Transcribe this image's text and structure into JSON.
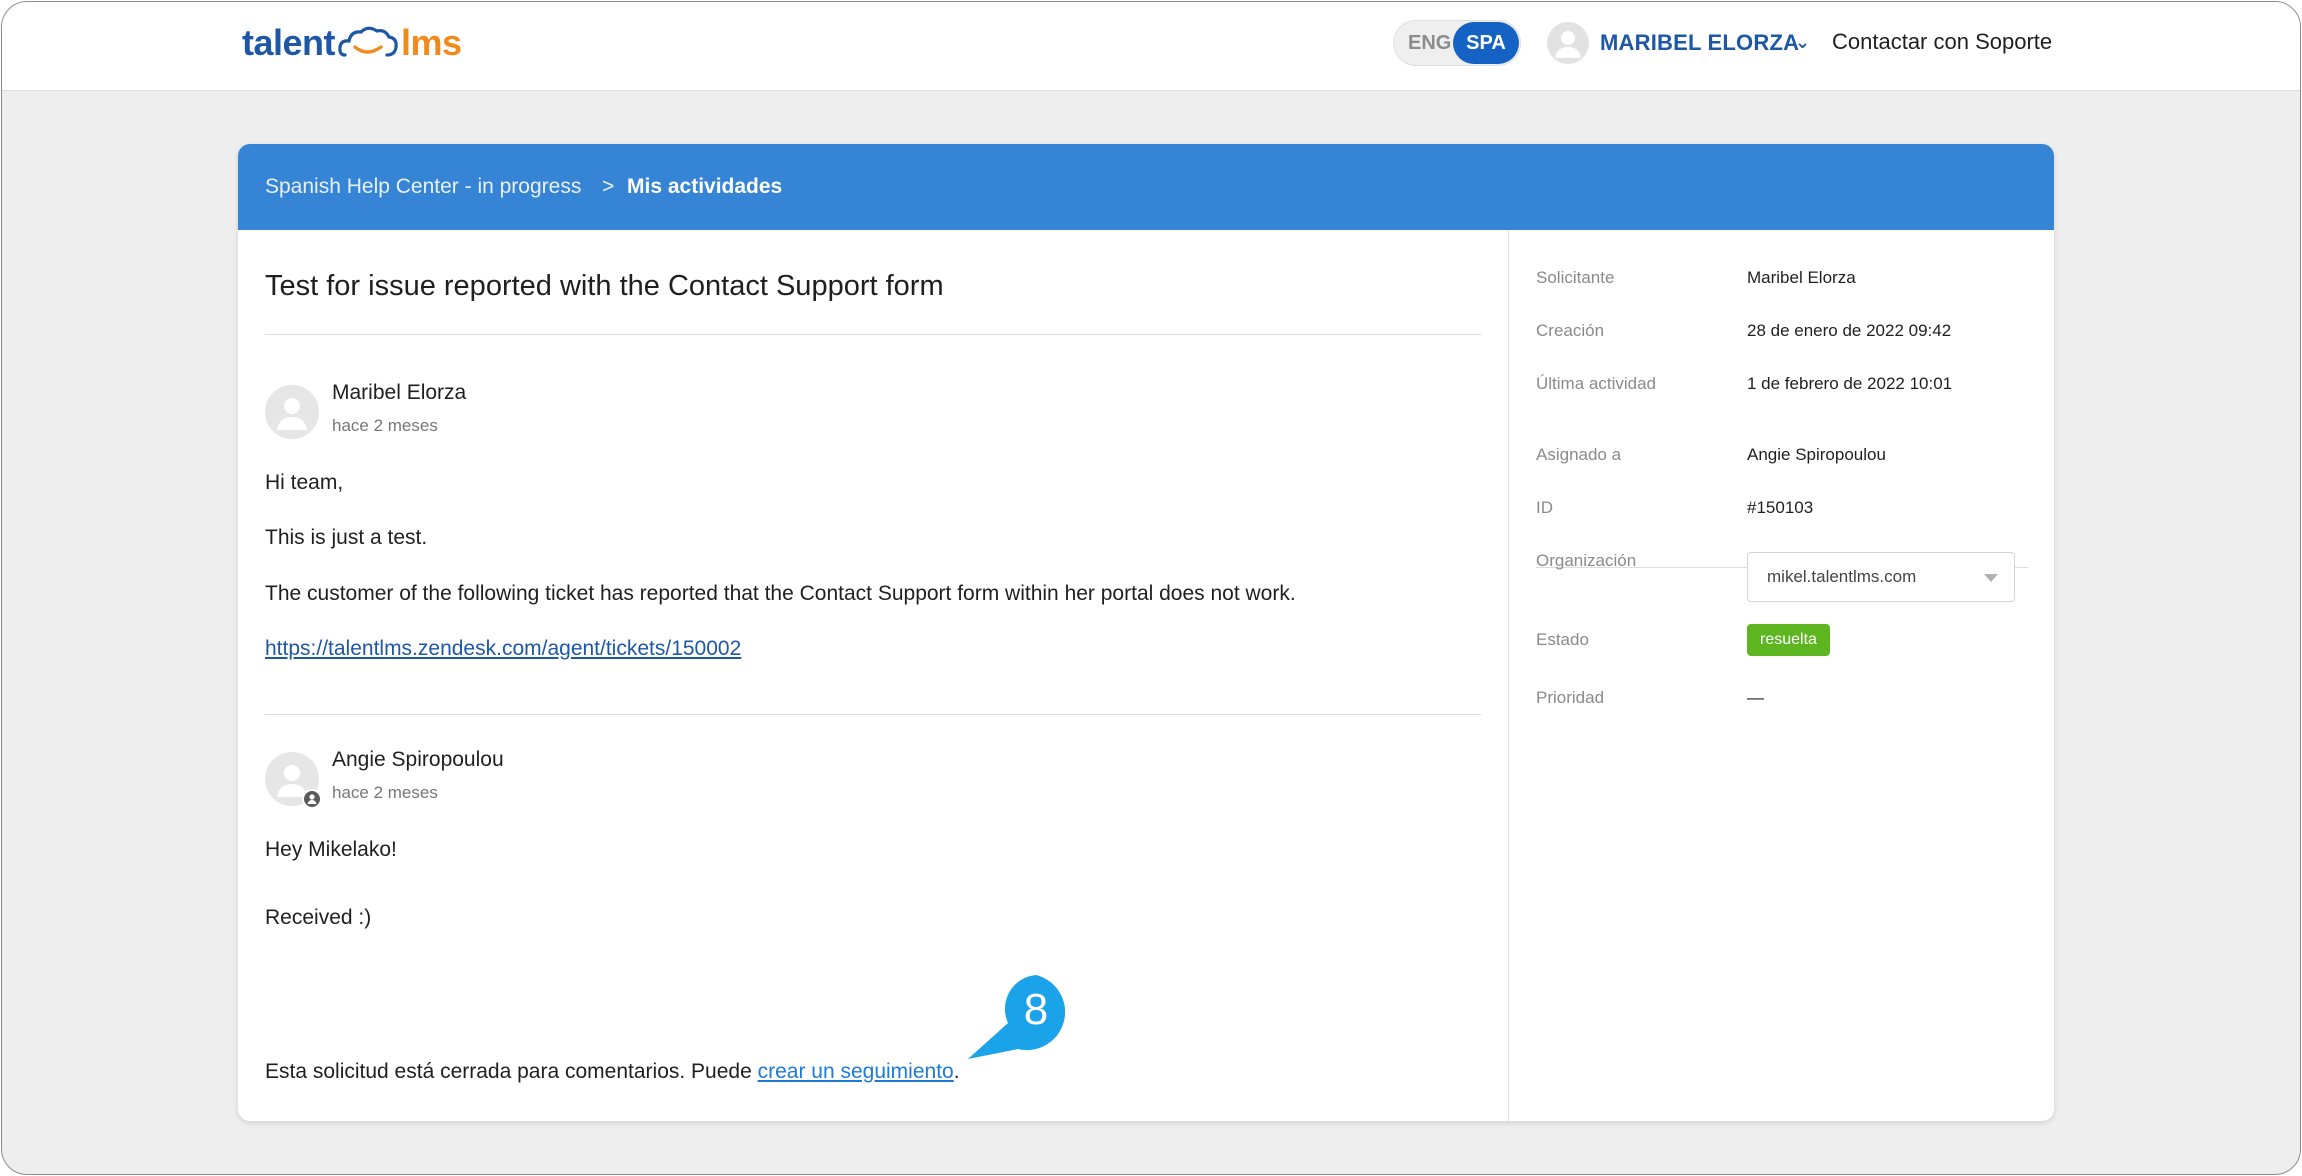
{
  "header": {
    "logo_left": "talent",
    "logo_right": "lms",
    "lang_eng": "ENG",
    "lang_spa": "SPA",
    "user_name": "MARIBEL ELORZA",
    "chevron": "⌄",
    "support_link": "Contactar con Soporte"
  },
  "breadcrumb": {
    "parent": "Spanish Help Center - in progress",
    "separator": ">",
    "current": "Mis actividades"
  },
  "ticket": {
    "title": "Test for issue reported with the Contact Support form",
    "comments": [
      {
        "author": "Maribel Elorza",
        "time": "hace 2 meses",
        "lines": [
          "Hi team,",
          "This is just a test.",
          "The customer of the following ticket has reported that the Contact Support form within her portal does not work."
        ],
        "link": "https://talentlms.zendesk.com/agent/tickets/150002"
      },
      {
        "author": "Angie Spiropoulou",
        "time": "hace 2 meses",
        "lines": [
          "Hey Mikelako!",
          "Received :)"
        ]
      }
    ],
    "closed_text": "Esta solicitud está cerrada para comentarios. Puede ",
    "followup_link": "crear un seguimiento",
    "closed_period": ".",
    "step_marker": "8"
  },
  "details": {
    "requester_label": "Solicitante",
    "requester": "Maribel Elorza",
    "created_label": "Creación",
    "created": "28 de enero de 2022 09:42",
    "last_activity_label": "Última actividad",
    "last_activity": "1 de febrero de 2022 10:01",
    "assigned_label": "Asignado a",
    "assigned": "Angie Spiropoulou",
    "id_label": "ID",
    "id": "#150103",
    "org_label": "Organización",
    "org": "mikel.talentlms.com",
    "status_label": "Estado",
    "status": "resuelta",
    "priority_label": "Prioridad",
    "priority": "—"
  },
  "colors": {
    "brand_blue": "#1d57a6",
    "banner_blue": "#3584d6",
    "brand_orange": "#f08a1c",
    "status_green": "#5db61f",
    "marker_blue": "#1aa3e8"
  },
  "icons": [
    "cloud-logo-icon",
    "user-avatar-icon",
    "chevron-down-icon",
    "agent-badge-icon",
    "dropdown-caret-icon"
  ]
}
